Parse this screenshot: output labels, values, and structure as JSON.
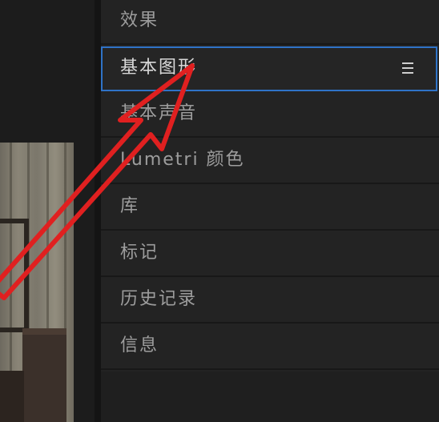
{
  "panel_menu": {
    "items": [
      {
        "label": "效果"
      },
      {
        "label": "基本图形",
        "selected": true,
        "icon": "hamburger-menu-icon"
      },
      {
        "label": "基本声音"
      },
      {
        "label": "Lumetri 颜色"
      },
      {
        "label": "库"
      },
      {
        "label": "标记"
      },
      {
        "label": "历史记录"
      },
      {
        "label": "信息"
      }
    ]
  },
  "colors": {
    "selection_border": "#2f73c7",
    "annotation_arrow": "#e02020",
    "panel_bg": "#232323"
  }
}
